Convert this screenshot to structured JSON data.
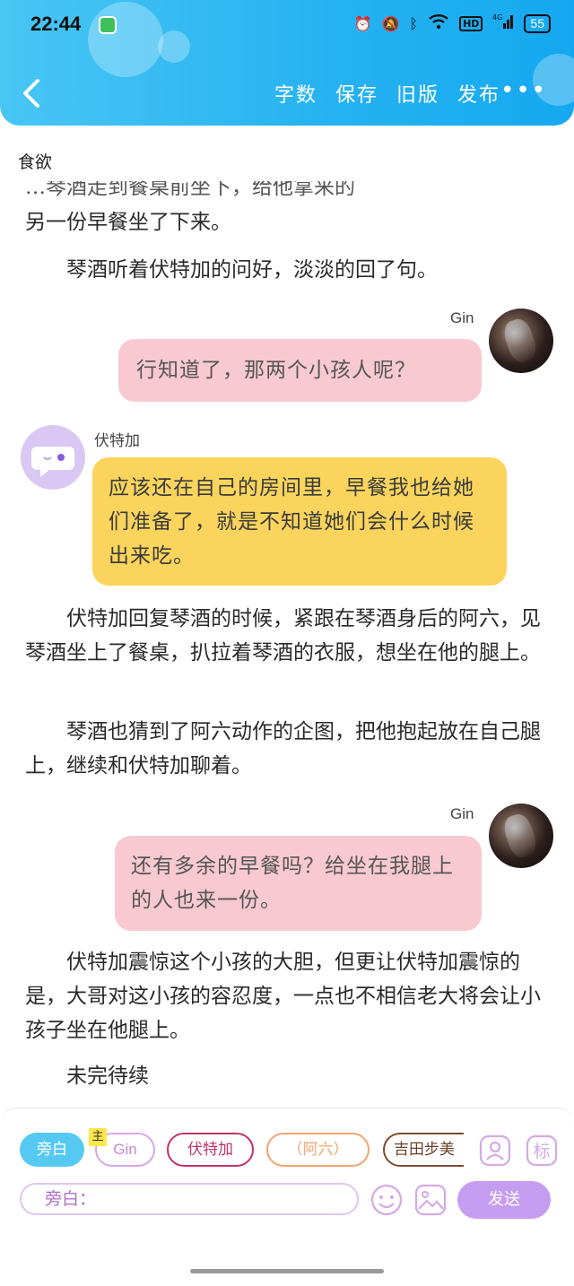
{
  "status_bar": {
    "time": "22:44",
    "network": "4G",
    "hd": "HD",
    "battery": "55"
  },
  "toolbar": {
    "actions": [
      "字数",
      "保存",
      "旧版",
      "发布"
    ],
    "more": "•••"
  },
  "chapter_title": "食欲",
  "content": {
    "cut_line": "…琴酒走到餐桌前坐下，给他拿来的",
    "p1": "另一份早餐坐了下来。",
    "p2": "琴酒听着伏特加的问好，淡淡的回了句。",
    "msg1": {
      "speaker": "Gin",
      "text": "行知道了，那两个小孩人呢？"
    },
    "msg2": {
      "speaker": "伏特加",
      "text": "应该还在自己的房间里，早餐我也给她们准备了，就是不知道她们会什么时候出来吃。"
    },
    "p3": "伏特加回复琴酒的时候，紧跟在琴酒身后的阿六，见琴酒坐上了餐桌，扒拉着琴酒的衣服，想坐在他的腿上。",
    "p4": "琴酒也猜到了阿六动作的企图，把他抱起放在自己腿上，继续和伏特加聊着。",
    "msg3": {
      "speaker": "Gin",
      "text": "还有多余的早餐吗？给坐在我腿上的人也来一份。"
    },
    "p5": "伏特加震惊这个小孩的大胆，但更让伏特加震惊的是，大哥对这小孩的容忍度，一点也不相信老大将会让小孩子坐在他腿上。",
    "p6": "未完待续"
  },
  "editor": {
    "roles": [
      "旁白",
      "Gin",
      "伏特加",
      "（阿六）",
      "吉田步美"
    ],
    "main_badge": "主",
    "input_value": "旁白：",
    "send_label": "发送",
    "label_icon_text": "标"
  },
  "colors": {
    "header": "#27b3f2",
    "pink_bubble": "#f8c9d1",
    "yellow_bubble": "#fad45c",
    "send": "#c69cf0",
    "narration_chip": "#55c9f2"
  }
}
